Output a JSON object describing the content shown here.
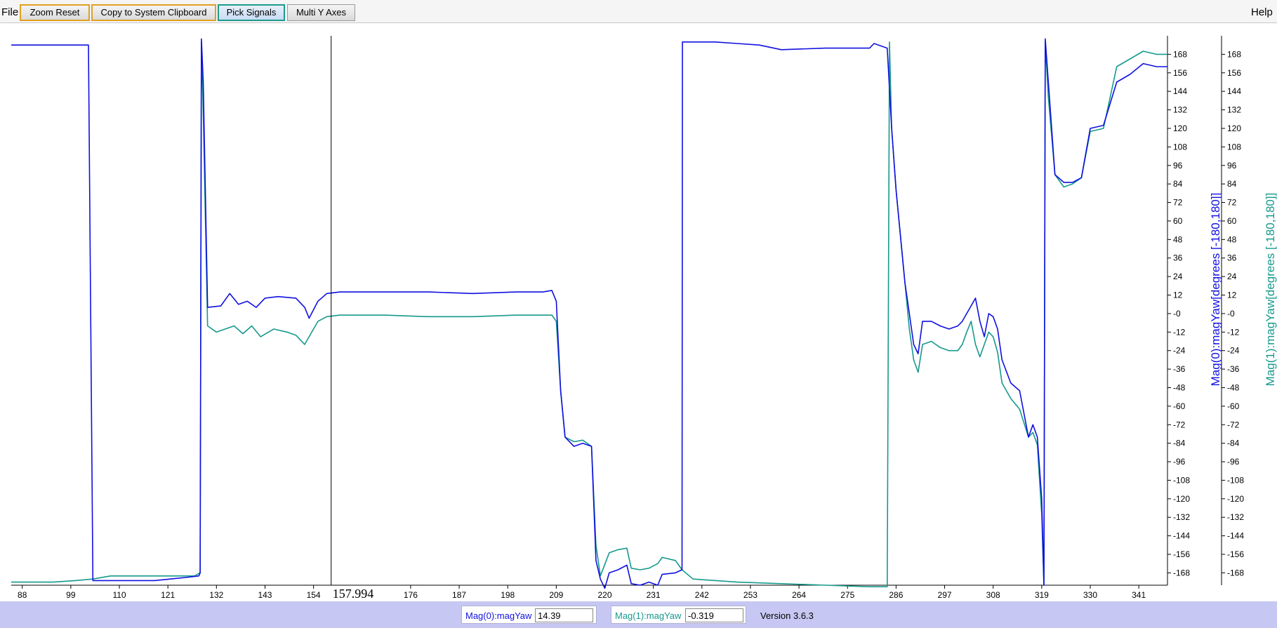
{
  "menu": {
    "file": "File",
    "help": "Help"
  },
  "toolbar": {
    "zoom_reset": "Zoom Reset",
    "copy_clipboard": "Copy to System Clipboard",
    "pick_signals": "Pick Signals",
    "multi_y_axes": "Multi Y Axes"
  },
  "cursor": {
    "label": "157.994",
    "x": 157.994
  },
  "colors": {
    "series0": "#1010e0",
    "series1": "#16998c",
    "statusbar": "#c6c8f3"
  },
  "chart_data": {
    "type": "line",
    "xlim": [
      85.5,
      347.5
    ],
    "ylim": [
      -176,
      180
    ],
    "x_ticks": [
      88,
      99,
      110,
      121,
      132,
      143,
      154,
      176,
      187,
      198,
      209,
      220,
      231,
      242,
      253,
      264,
      275,
      286,
      297,
      308,
      319,
      330,
      341
    ],
    "y_ticks": [
      168,
      156,
      144,
      132,
      120,
      108,
      96,
      84,
      72,
      60,
      48,
      36,
      24,
      12,
      0,
      -12,
      -24,
      -36,
      -48,
      -60,
      -72,
      -84,
      -96,
      -108,
      -120,
      -132,
      -144,
      -156,
      -168
    ],
    "y_tick_labels": [
      "168",
      "156",
      "144",
      "132",
      "120",
      "108",
      "96",
      "84",
      "72",
      "60",
      "48",
      "36",
      "24",
      "12",
      "-0",
      "-12",
      "-24",
      "-36",
      "-48",
      "-60",
      "-72",
      "-84",
      "-96",
      "-108",
      "-120",
      "-132",
      "-144",
      "-156",
      "-168"
    ],
    "y_axis_labels": [
      "Mag(0):magYaw[degrees [-180,180]]",
      "Mag(1):magYaw[degrees [-180,180]]"
    ],
    "series": [
      {
        "name": "Mag(0):magYaw",
        "color": "#1010e0",
        "points": [
          [
            85.5,
            174
          ],
          [
            95,
            174
          ],
          [
            103,
            174
          ],
          [
            104,
            -173
          ],
          [
            108,
            -173
          ],
          [
            118,
            -173
          ],
          [
            125,
            -171
          ],
          [
            128,
            -170
          ],
          [
            128.3,
            -168
          ],
          [
            128.6,
            178
          ],
          [
            129,
            150
          ],
          [
            130,
            4
          ],
          [
            133,
            5
          ],
          [
            135,
            13
          ],
          [
            137,
            6
          ],
          [
            139,
            8
          ],
          [
            141,
            4
          ],
          [
            143,
            10
          ],
          [
            146,
            11
          ],
          [
            150,
            10
          ],
          [
            152,
            4
          ],
          [
            153,
            -3
          ],
          [
            155,
            8
          ],
          [
            157,
            13
          ],
          [
            160,
            14
          ],
          [
            170,
            14
          ],
          [
            180,
            14
          ],
          [
            190,
            13
          ],
          [
            200,
            14
          ],
          [
            206,
            14
          ],
          [
            208,
            15
          ],
          [
            209,
            8
          ],
          [
            210,
            -50
          ],
          [
            211,
            -80
          ],
          [
            213,
            -86
          ],
          [
            215,
            -84
          ],
          [
            217,
            -86
          ],
          [
            218,
            -160
          ],
          [
            219,
            -172
          ],
          [
            220,
            -178
          ],
          [
            221,
            -168
          ],
          [
            223,
            -166
          ],
          [
            225,
            -163
          ],
          [
            226,
            -175
          ],
          [
            228,
            -176
          ],
          [
            230,
            -174
          ],
          [
            232,
            -176
          ],
          [
            233,
            -169
          ],
          [
            236,
            -168
          ],
          [
            237.5,
            -166
          ],
          [
            237.6,
            176
          ],
          [
            240,
            176
          ],
          [
            245,
            176
          ],
          [
            250,
            175
          ],
          [
            255,
            174
          ],
          [
            260,
            171
          ],
          [
            270,
            172
          ],
          [
            280,
            172
          ],
          [
            281,
            175
          ],
          [
            284,
            172
          ],
          [
            285,
            120
          ],
          [
            286,
            80
          ],
          [
            287,
            50
          ],
          [
            288,
            20
          ],
          [
            289,
            0
          ],
          [
            290,
            -20
          ],
          [
            291,
            -26
          ],
          [
            292,
            -5
          ],
          [
            294,
            -5
          ],
          [
            296,
            -8
          ],
          [
            298,
            -10
          ],
          [
            300,
            -8
          ],
          [
            301,
            -5
          ],
          [
            302,
            0
          ],
          [
            303,
            5
          ],
          [
            304,
            10
          ],
          [
            305,
            -5
          ],
          [
            306,
            -15
          ],
          [
            307,
            0
          ],
          [
            308,
            -2
          ],
          [
            309,
            -10
          ],
          [
            310,
            -30
          ],
          [
            312,
            -45
          ],
          [
            314,
            -50
          ],
          [
            316,
            -80
          ],
          [
            317,
            -72
          ],
          [
            318,
            -80
          ],
          [
            319,
            -120
          ],
          [
            319.5,
            -176
          ],
          [
            319.8,
            178
          ],
          [
            320.5,
            150
          ],
          [
            322,
            90
          ],
          [
            324,
            85
          ],
          [
            326,
            85
          ],
          [
            328,
            88
          ],
          [
            330,
            120
          ],
          [
            333,
            122
          ],
          [
            336,
            150
          ],
          [
            339,
            155
          ],
          [
            342,
            162
          ],
          [
            345,
            160
          ],
          [
            347.5,
            160
          ]
        ]
      },
      {
        "name": "Mag(1):magYaw",
        "color": "#16998c",
        "points": [
          [
            85.5,
            -174
          ],
          [
            90,
            -174
          ],
          [
            95,
            -174
          ],
          [
            100,
            -173
          ],
          [
            104,
            -172
          ],
          [
            108,
            -170
          ],
          [
            118,
            -170
          ],
          [
            127,
            -170
          ],
          [
            128.3,
            -168
          ],
          [
            128.6,
            176
          ],
          [
            129,
            130
          ],
          [
            130,
            -8
          ],
          [
            132,
            -12
          ],
          [
            134,
            -10
          ],
          [
            136,
            -8
          ],
          [
            138,
            -13
          ],
          [
            140,
            -8
          ],
          [
            142,
            -15
          ],
          [
            145,
            -10
          ],
          [
            148,
            -12
          ],
          [
            150,
            -14
          ],
          [
            152,
            -20
          ],
          [
            153,
            -15
          ],
          [
            155,
            -5
          ],
          [
            157,
            -2
          ],
          [
            160,
            -1
          ],
          [
            170,
            -1
          ],
          [
            180,
            -2
          ],
          [
            190,
            -2
          ],
          [
            200,
            -1
          ],
          [
            206,
            -1
          ],
          [
            208,
            -1
          ],
          [
            209,
            -5
          ],
          [
            210,
            -50
          ],
          [
            211,
            -80
          ],
          [
            213,
            -83
          ],
          [
            215,
            -82
          ],
          [
            217,
            -86
          ],
          [
            218,
            -150
          ],
          [
            219,
            -170
          ],
          [
            221,
            -155
          ],
          [
            223,
            -153
          ],
          [
            225,
            -152
          ],
          [
            226,
            -165
          ],
          [
            228,
            -166
          ],
          [
            230,
            -165
          ],
          [
            232,
            -162
          ],
          [
            233,
            -158
          ],
          [
            236,
            -160
          ],
          [
            237.5,
            -166
          ],
          [
            240,
            -172
          ],
          [
            250,
            -174
          ],
          [
            260,
            -175
          ],
          [
            270,
            -176
          ],
          [
            280,
            -177
          ],
          [
            284,
            -177
          ],
          [
            284.5,
            176
          ],
          [
            285,
            120
          ],
          [
            286,
            80
          ],
          [
            287,
            50
          ],
          [
            288,
            20
          ],
          [
            289,
            -10
          ],
          [
            290,
            -30
          ],
          [
            291,
            -38
          ],
          [
            292,
            -20
          ],
          [
            294,
            -18
          ],
          [
            296,
            -22
          ],
          [
            298,
            -24
          ],
          [
            300,
            -24
          ],
          [
            301,
            -20
          ],
          [
            302,
            -12
          ],
          [
            303,
            -5
          ],
          [
            304,
            -20
          ],
          [
            305,
            -28
          ],
          [
            306,
            -20
          ],
          [
            307,
            -12
          ],
          [
            308,
            -15
          ],
          [
            309,
            -25
          ],
          [
            310,
            -45
          ],
          [
            312,
            -55
          ],
          [
            314,
            -62
          ],
          [
            316,
            -80
          ],
          [
            317,
            -77
          ],
          [
            318,
            -85
          ],
          [
            319,
            -130
          ],
          [
            319.5,
            -176
          ],
          [
            319.8,
            176
          ],
          [
            320.5,
            140
          ],
          [
            322,
            90
          ],
          [
            324,
            82
          ],
          [
            326,
            84
          ],
          [
            328,
            88
          ],
          [
            330,
            118
          ],
          [
            333,
            120
          ],
          [
            336,
            160
          ],
          [
            339,
            165
          ],
          [
            342,
            170
          ],
          [
            345,
            168
          ],
          [
            347.5,
            168
          ]
        ]
      }
    ],
    "grid": false,
    "legend": "none"
  },
  "status": {
    "series0_label": "Mag(0):magYaw",
    "series0_value": "14.39",
    "series1_label": "Mag(1):magYaw",
    "series1_value": "-0.319",
    "version": "Version 3.6.3"
  }
}
